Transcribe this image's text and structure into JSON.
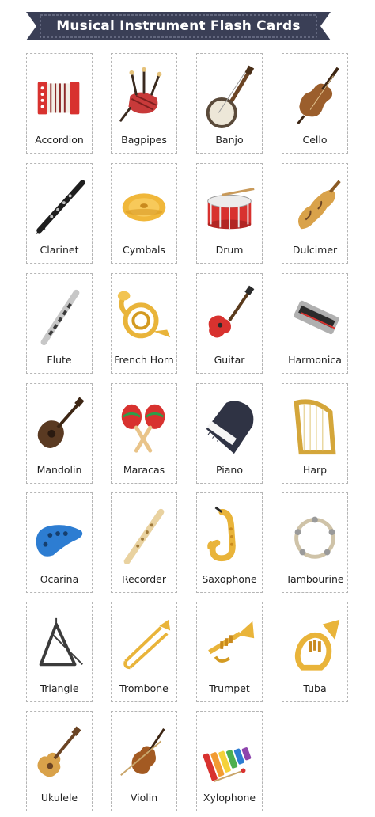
{
  "title": "Musical Instrument Flash Cards",
  "colors": {
    "banner": "#3a3f56",
    "card_border": "#b5b5b5"
  },
  "cards": [
    {
      "label": "Accordion",
      "icon": "accordion-icon"
    },
    {
      "label": "Bagpipes",
      "icon": "bagpipes-icon"
    },
    {
      "label": "Banjo",
      "icon": "banjo-icon"
    },
    {
      "label": "Cello",
      "icon": "cello-icon"
    },
    {
      "label": "Clarinet",
      "icon": "clarinet-icon"
    },
    {
      "label": "Cymbals",
      "icon": "cymbals-icon"
    },
    {
      "label": "Drum",
      "icon": "drum-icon"
    },
    {
      "label": "Dulcimer",
      "icon": "dulcimer-icon"
    },
    {
      "label": "Flute",
      "icon": "flute-icon"
    },
    {
      "label": "French Horn",
      "icon": "french-horn-icon"
    },
    {
      "label": "Guitar",
      "icon": "guitar-icon"
    },
    {
      "label": "Harmonica",
      "icon": "harmonica-icon"
    },
    {
      "label": "Mandolin",
      "icon": "mandolin-icon"
    },
    {
      "label": "Maracas",
      "icon": "maracas-icon"
    },
    {
      "label": "Piano",
      "icon": "piano-icon"
    },
    {
      "label": "Harp",
      "icon": "harp-icon"
    },
    {
      "label": "Ocarina",
      "icon": "ocarina-icon"
    },
    {
      "label": "Recorder",
      "icon": "recorder-icon"
    },
    {
      "label": "Saxophone",
      "icon": "saxophone-icon"
    },
    {
      "label": "Tambourine",
      "icon": "tambourine-icon"
    },
    {
      "label": "Triangle",
      "icon": "triangle-icon"
    },
    {
      "label": "Trombone",
      "icon": "trombone-icon"
    },
    {
      "label": "Trumpet",
      "icon": "trumpet-icon"
    },
    {
      "label": "Tuba",
      "icon": "tuba-icon"
    },
    {
      "label": "Ukulele",
      "icon": "ukulele-icon"
    },
    {
      "label": "Violin",
      "icon": "violin-icon"
    },
    {
      "label": "Xylophone",
      "icon": "xylophone-icon"
    }
  ]
}
